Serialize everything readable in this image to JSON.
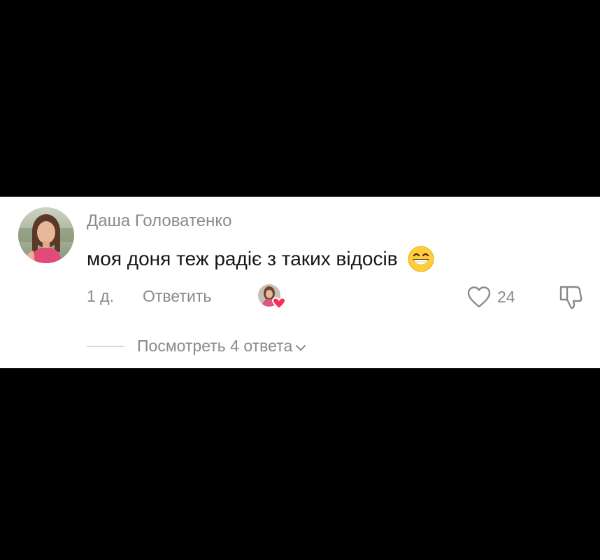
{
  "comment": {
    "username": "Даша Головатенко",
    "text": "моя доня теж радіє з таких відосів",
    "emoji": "grinning-face-with-smiling-eyes",
    "timestamp": "1 д.",
    "reply_label": "Ответить",
    "like_count": "24",
    "view_replies_label": "Посмотреть 4 ответа"
  },
  "colors": {
    "background": "#000000",
    "card": "#ffffff",
    "text_primary": "#161616",
    "text_secondary": "#8a8a8a",
    "liked_heart": "#fe2c55"
  },
  "icons": {
    "avatar": "user-avatar-photo",
    "creator_liked": "creator-liked-badge",
    "like": "heart-outline-icon",
    "dislike": "thumbs-down-icon",
    "expand": "chevron-down-icon"
  }
}
